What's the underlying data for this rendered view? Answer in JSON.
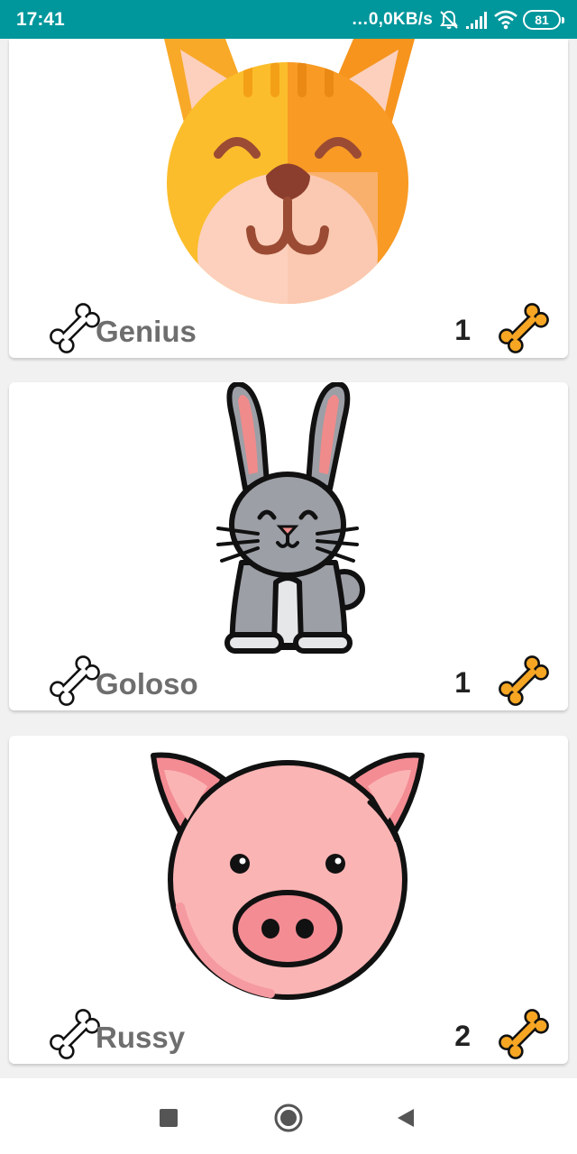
{
  "status_bar": {
    "time": "17:41",
    "network_speed": "…0,0KB/s",
    "battery": "81",
    "icons": [
      "mute-icon",
      "signal-icon",
      "wifi-icon",
      "battery-icon"
    ]
  },
  "pets": [
    {
      "name": "Genius",
      "count": "1",
      "image": "cat-icon"
    },
    {
      "name": "Goloso",
      "count": "1",
      "image": "rabbit-icon"
    },
    {
      "name": "Russy",
      "count": "2",
      "image": "pig-icon"
    }
  ],
  "colors": {
    "status_bar": "#00979c",
    "bone_filled": "#f6a623",
    "name_text": "#6e6e6e"
  },
  "nav": {
    "icons": [
      "recent-apps-icon",
      "home-icon",
      "back-icon"
    ]
  }
}
